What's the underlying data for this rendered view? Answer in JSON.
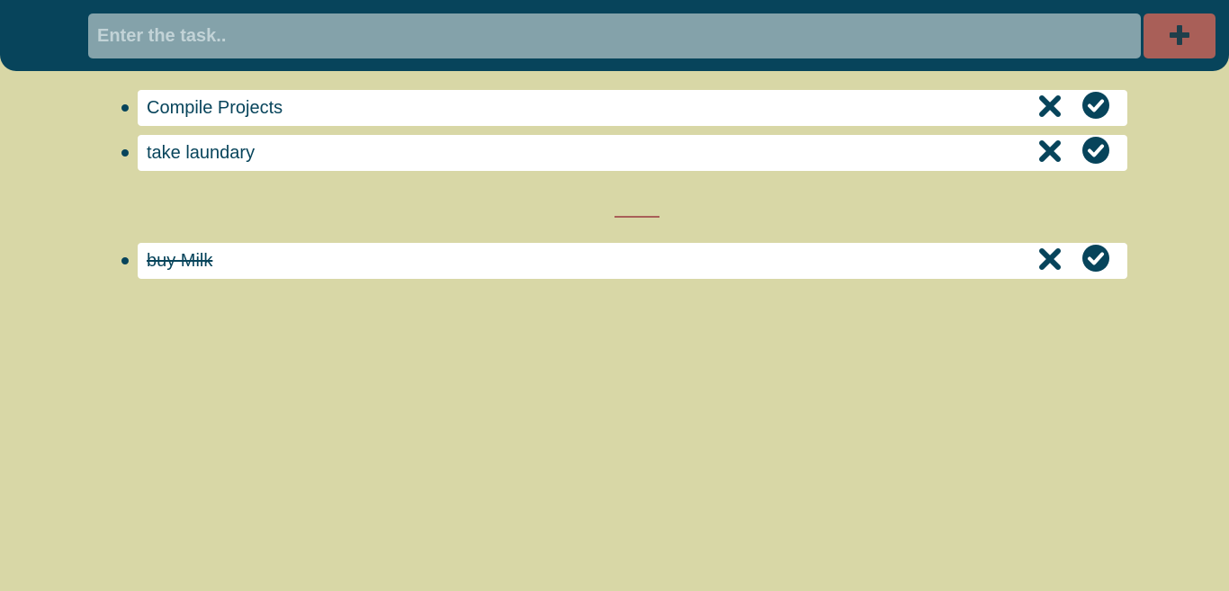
{
  "header": {
    "input_placeholder": "Enter the task..",
    "input_value": "",
    "add_icon": "plus-icon"
  },
  "todo": {
    "items": [
      {
        "label": "Compile Projects",
        "completed": false
      },
      {
        "label": "take laundary",
        "completed": false
      }
    ]
  },
  "completed": {
    "items": [
      {
        "label": "buy Milk",
        "completed": true
      }
    ]
  },
  "icons": {
    "delete": "close-icon",
    "complete": "check-circle-icon"
  },
  "colors": {
    "background": "#d8d7a6",
    "header": "#07445b",
    "input": "#84a2aa",
    "add_button": "#a95f58",
    "divider": "#a95f58",
    "text": "#07445b",
    "card": "#ffffff"
  }
}
